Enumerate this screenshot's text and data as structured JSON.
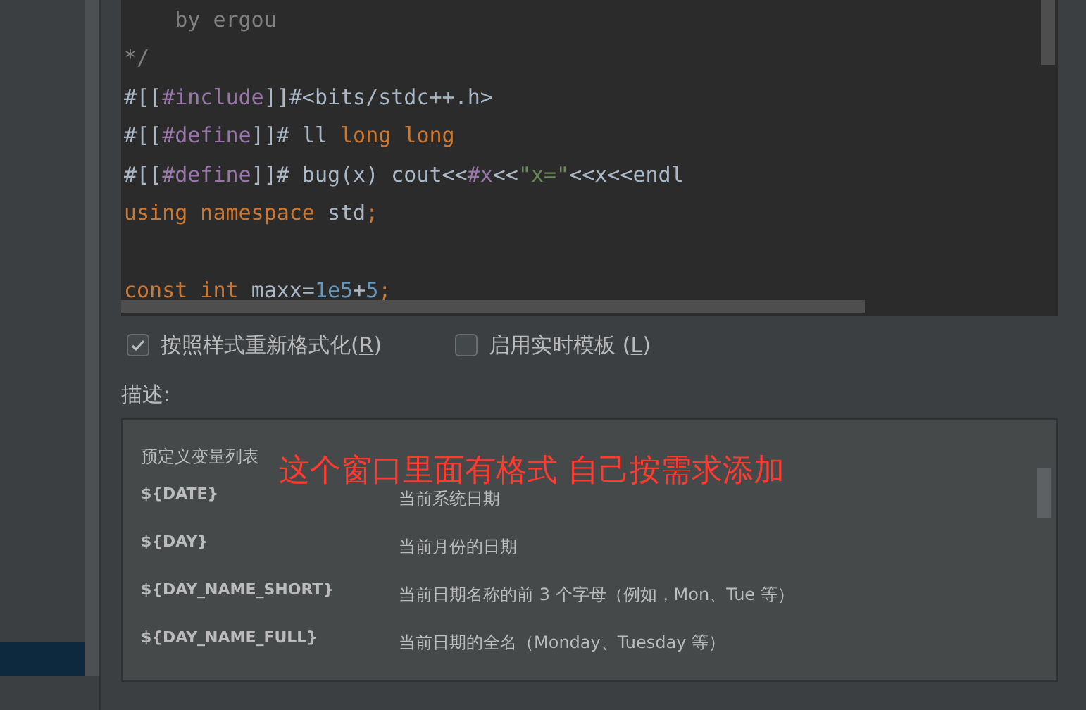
{
  "editor": {
    "lines": [
      [
        {
          "kind": "comment",
          "text": "    by ergou"
        }
      ],
      [
        {
          "kind": "comment",
          "text": "*/"
        }
      ],
      [
        {
          "kind": "plain",
          "text": "#[["
        },
        {
          "kind": "directive",
          "text": "#include"
        },
        {
          "kind": "plain",
          "text": "]]#<bits/stdc++.h>"
        }
      ],
      [
        {
          "kind": "plain",
          "text": "#[["
        },
        {
          "kind": "directive",
          "text": "#define"
        },
        {
          "kind": "plain",
          "text": "]]# ll "
        },
        {
          "kind": "keyword",
          "text": "long long"
        }
      ],
      [
        {
          "kind": "plain",
          "text": "#[["
        },
        {
          "kind": "directive",
          "text": "#define"
        },
        {
          "kind": "plain",
          "text": "]]# bug(x) cout<<"
        },
        {
          "kind": "directive",
          "text": "#x"
        },
        {
          "kind": "plain",
          "text": "<<"
        },
        {
          "kind": "string",
          "text": "\"x=\""
        },
        {
          "kind": "plain",
          "text": "<<x<<endl"
        }
      ],
      [
        {
          "kind": "keyword",
          "text": "using namespace "
        },
        {
          "kind": "plain",
          "text": "std"
        },
        {
          "kind": "keyword",
          "text": ";"
        }
      ],
      {
        "kind": "blank"
      },
      [
        {
          "kind": "keyword",
          "text": "const int "
        },
        {
          "kind": "plain",
          "text": "maxx="
        },
        {
          "kind": "number",
          "text": "1e5"
        },
        {
          "kind": "plain",
          "text": "+"
        },
        {
          "kind": "number",
          "text": "5"
        },
        {
          "kind": "keyword",
          "text": ";"
        }
      ]
    ]
  },
  "options": [
    {
      "label": "按照样式重新格式化(",
      "mnemonic": "R",
      "suffix": ")",
      "checked": true
    },
    {
      "label": "启用实时模板 (",
      "mnemonic": "L",
      "suffix": ")",
      "checked": false
    }
  ],
  "description": {
    "label": "描述:",
    "heading": "预定义变量列表",
    "annotation": "这个窗口里面有格式 自己按需求添加",
    "variables": [
      {
        "name": "${DATE}",
        "meaning": "当前系统日期"
      },
      {
        "name": "${DAY}",
        "meaning": "当前月份的日期"
      },
      {
        "name": "${DAY_NAME_SHORT}",
        "meaning": "当前日期名称的前 3 个字母（例如，Mon、Tue 等）"
      },
      {
        "name": "${DAY_NAME_FULL}",
        "meaning": "当前日期的全名（Monday、Tuesday 等）"
      }
    ]
  }
}
